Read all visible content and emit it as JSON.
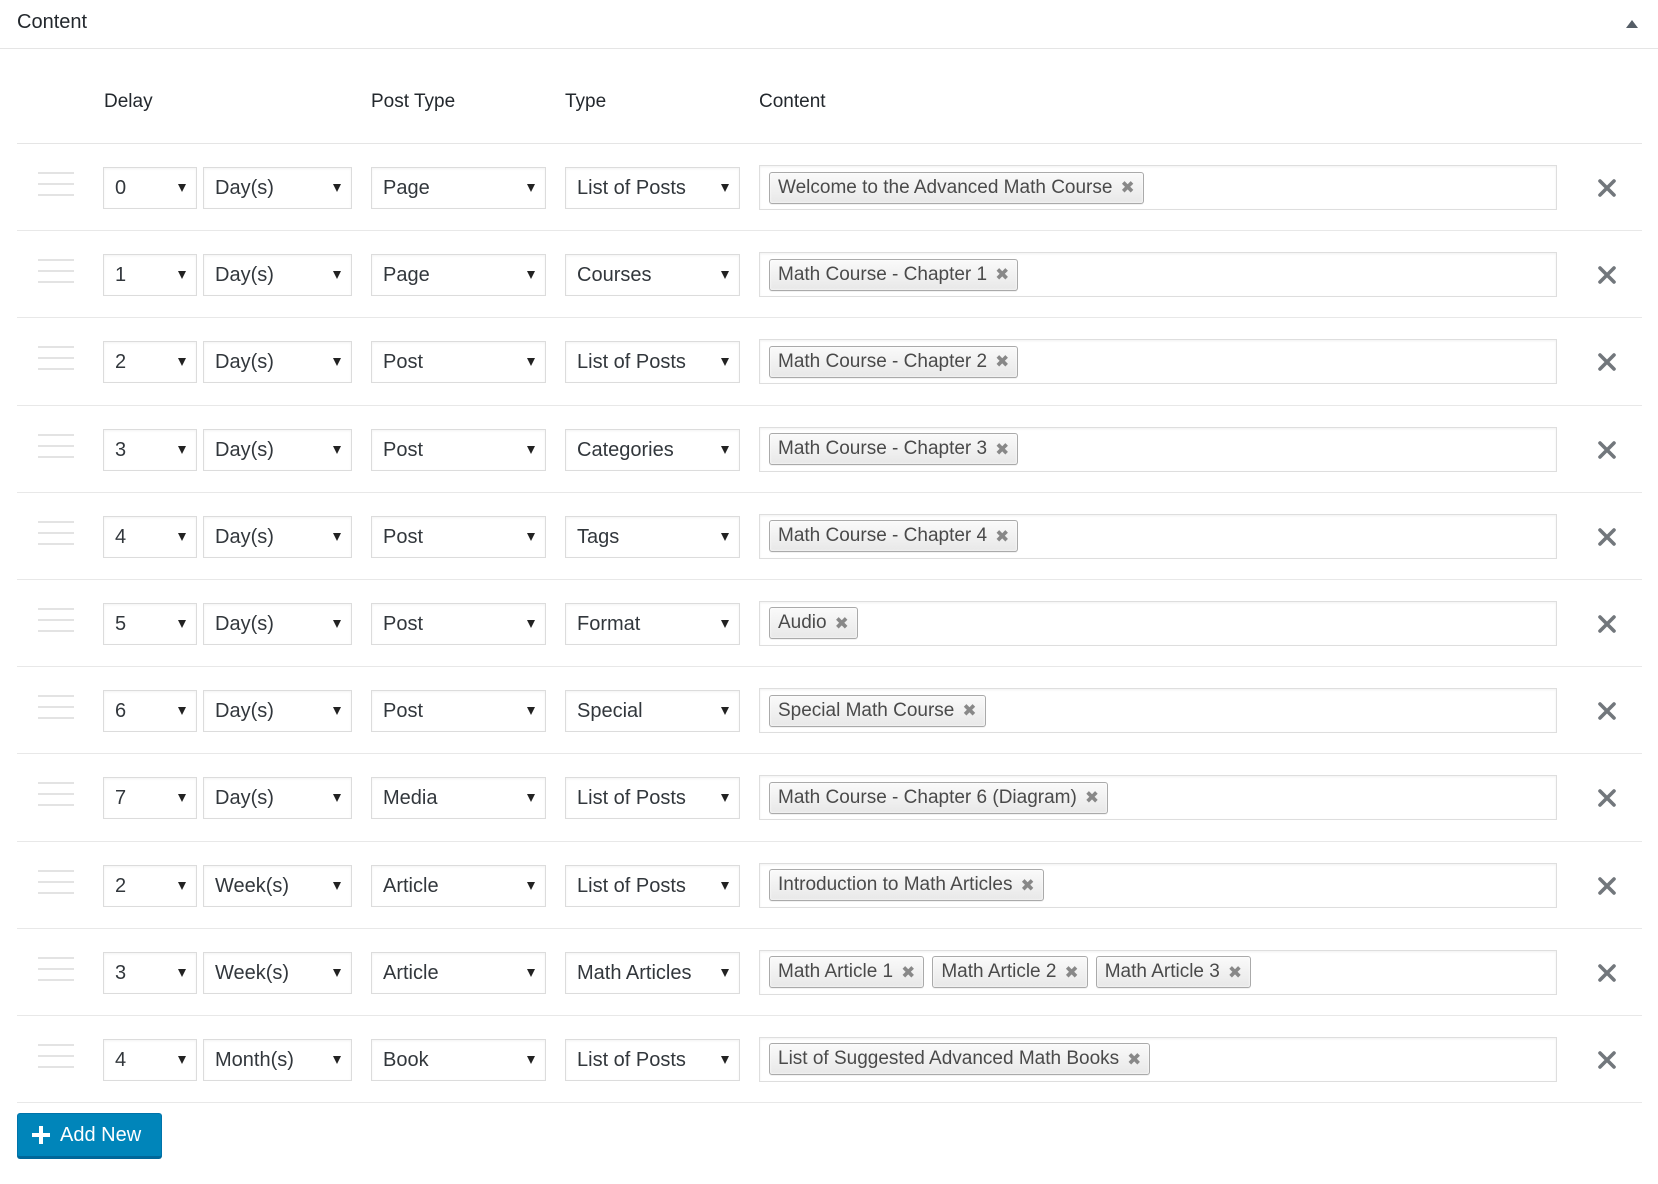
{
  "panel": {
    "title": "Content",
    "collapse_icon": "triangle-up-icon"
  },
  "columns": {
    "delay": "Delay",
    "post_type": "Post Type",
    "type": "Type",
    "content": "Content"
  },
  "rows": [
    {
      "delay": "0",
      "unit": "Day(s)",
      "post_type": "Page",
      "type": "List of Posts",
      "content": [
        "Welcome to the Advanced Math Course"
      ]
    },
    {
      "delay": "1",
      "unit": "Day(s)",
      "post_type": "Page",
      "type": "Courses",
      "content": [
        "Math Course - Chapter 1"
      ]
    },
    {
      "delay": "2",
      "unit": "Day(s)",
      "post_type": "Post",
      "type": "List of Posts",
      "content": [
        "Math Course - Chapter 2"
      ]
    },
    {
      "delay": "3",
      "unit": "Day(s)",
      "post_type": "Post",
      "type": "Categories",
      "content": [
        "Math Course - Chapter 3"
      ]
    },
    {
      "delay": "4",
      "unit": "Day(s)",
      "post_type": "Post",
      "type": "Tags",
      "content": [
        "Math Course - Chapter 4"
      ]
    },
    {
      "delay": "5",
      "unit": "Day(s)",
      "post_type": "Post",
      "type": "Format",
      "content": [
        "Audio"
      ]
    },
    {
      "delay": "6",
      "unit": "Day(s)",
      "post_type": "Post",
      "type": "Special",
      "content": [
        "Special Math Course"
      ]
    },
    {
      "delay": "7",
      "unit": "Day(s)",
      "post_type": "Media",
      "type": "List of Posts",
      "content": [
        "Math Course - Chapter 6 (Diagram)"
      ]
    },
    {
      "delay": "2",
      "unit": "Week(s)",
      "post_type": "Article",
      "type": "List of Posts",
      "content": [
        "Introduction to Math Articles"
      ]
    },
    {
      "delay": "3",
      "unit": "Week(s)",
      "post_type": "Article",
      "type": "Math Articles",
      "content": [
        "Math Article 1",
        "Math Article 2",
        "Math Article 3"
      ]
    },
    {
      "delay": "4",
      "unit": "Month(s)",
      "post_type": "Book",
      "type": "List of Posts",
      "content": [
        "List of Suggested Advanced Math Books"
      ]
    }
  ],
  "tag_remove_glyph": "✖",
  "actions": {
    "add_new_label": "Add New",
    "add_new_icon": "plus-icon",
    "remove_row_icon": "close-icon"
  },
  "colors": {
    "primary": "#0085ba",
    "primary_border": "#006799",
    "text": "#32373c",
    "remove_icon": "#72777c"
  }
}
